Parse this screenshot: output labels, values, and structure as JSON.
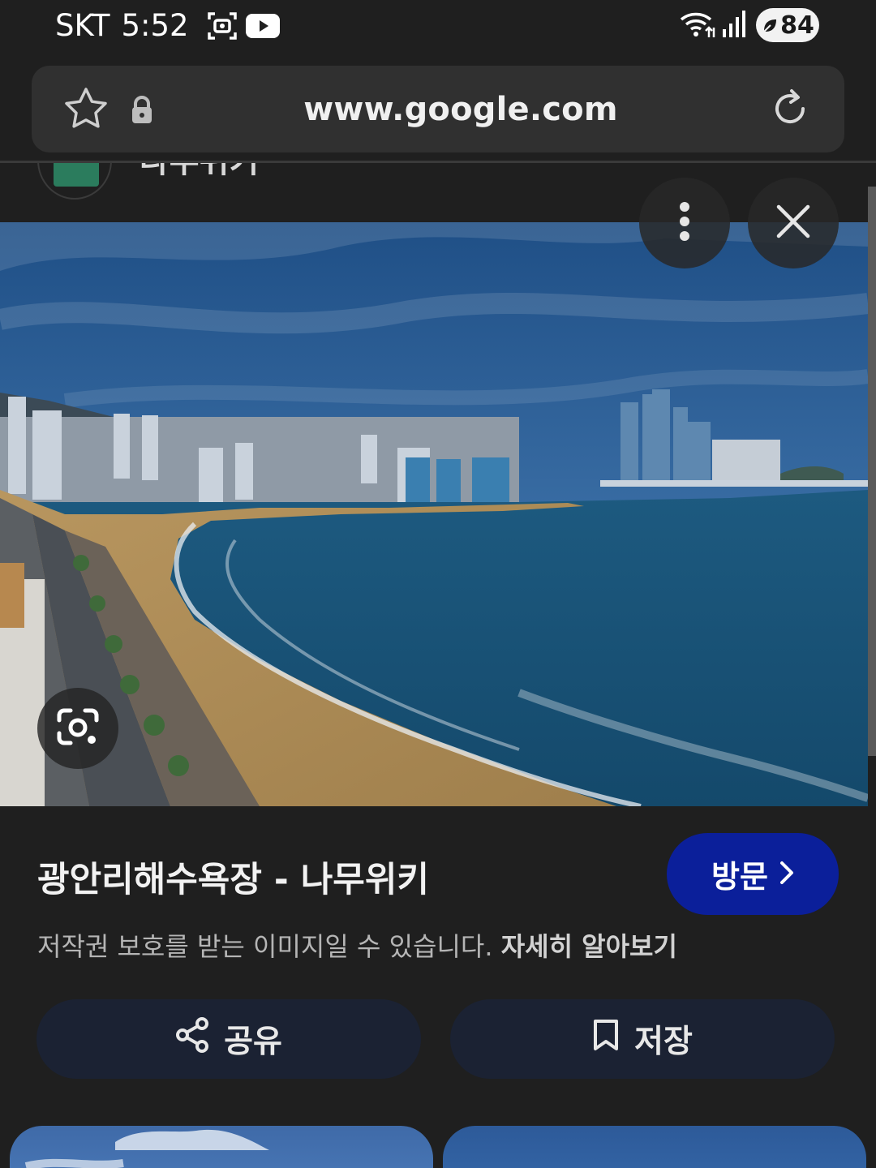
{
  "status_bar": {
    "carrier": "SKT",
    "time": "5:52",
    "battery": "84",
    "icons": [
      "screen-capture-icon",
      "youtube-icon",
      "wifi-icon",
      "signal-icon",
      "battery-icon"
    ]
  },
  "browser": {
    "url": "www.google.com",
    "icons": [
      "star-icon",
      "lock-icon",
      "reload-icon"
    ]
  },
  "source": {
    "name": "나무위키"
  },
  "image_viewer": {
    "icons": [
      "more-icon",
      "close-icon",
      "lens-icon"
    ],
    "title": "광안리해수욕장 - 나무위키",
    "visit_label": "방문",
    "copyright_notice": "저작권 보호를 받는 이미지일 수 있습니다.",
    "learn_more": "자세히 알아보기",
    "share_label": "공유",
    "save_label": "저장"
  },
  "colors": {
    "background": "#1f1f1f",
    "urlbar": "#303030",
    "visit_button": "#0b1f9a",
    "action_button": "#1b2233"
  }
}
